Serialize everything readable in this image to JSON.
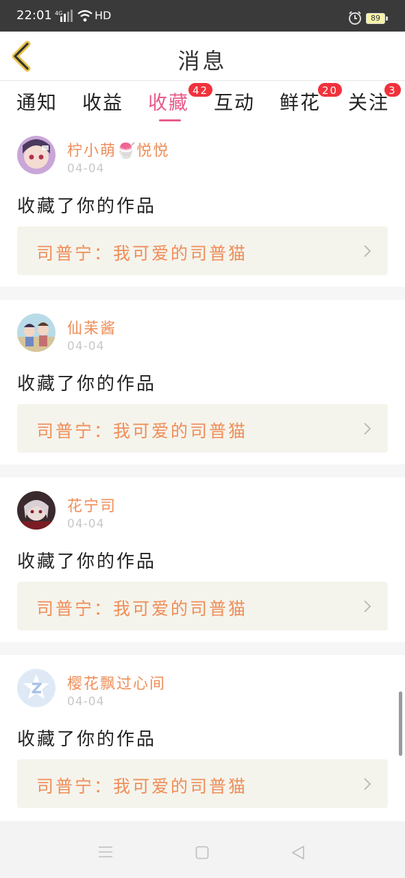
{
  "status_bar": {
    "time": "22:01",
    "network": "4G",
    "hd": "HD",
    "battery": "89",
    "icons": [
      "signal-icon",
      "wifi-icon",
      "alarm-icon",
      "battery-icon"
    ]
  },
  "header": {
    "title": "消息",
    "back_icon": "chevron-left-icon"
  },
  "tabs": [
    {
      "label": "通知",
      "badge": ""
    },
    {
      "label": "收益",
      "badge": ""
    },
    {
      "label": "收藏",
      "badge": "42",
      "active": true
    },
    {
      "label": "互动",
      "badge": ""
    },
    {
      "label": "鲜花",
      "badge": "20"
    },
    {
      "label": "关注",
      "badge": "3"
    }
  ],
  "messages": [
    {
      "username": "柠小萌🍧悦悦",
      "date": "04-04",
      "action": "收藏了你的作品",
      "work": "司普宁：我可爱的司普猫"
    },
    {
      "username": "仙苿酱",
      "date": "04-04",
      "action": "收藏了你的作品",
      "work": "司普宁：我可爱的司普猫"
    },
    {
      "username": "花宁司",
      "date": "04-04",
      "action": "收藏了你的作品",
      "work": "司普宁：我可爱的司普猫"
    },
    {
      "username": "樱花飘过心间",
      "date": "04-04",
      "action": "收藏了你的作品",
      "work": "司普宁：我可爱的司普猫"
    }
  ],
  "colors": {
    "accent": "#e85b8a",
    "username": "#ef8d58",
    "badge": "#f0323c",
    "work_box": "#f5f4ec"
  },
  "system_nav": {
    "icons": [
      "menu-icon",
      "home-icon",
      "back-icon"
    ]
  }
}
